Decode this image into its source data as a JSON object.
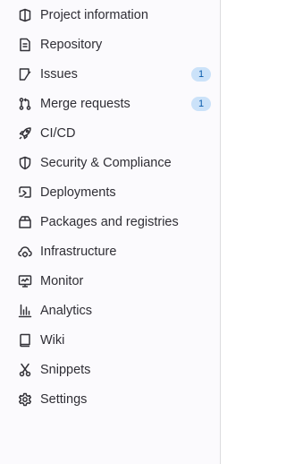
{
  "sidebar": {
    "items": [
      {
        "label": "Project information",
        "icon": "project-icon"
      },
      {
        "label": "Repository",
        "icon": "doc-text-icon"
      },
      {
        "label": "Issues",
        "icon": "issues-icon",
        "badge": "1"
      },
      {
        "label": "Merge requests",
        "icon": "merge-request-icon",
        "badge": "1"
      },
      {
        "label": "CI/CD",
        "icon": "rocket-icon"
      },
      {
        "label": "Security & Compliance",
        "icon": "shield-icon"
      },
      {
        "label": "Deployments",
        "icon": "deployments-icon"
      },
      {
        "label": "Packages and registries",
        "icon": "package-icon"
      },
      {
        "label": "Infrastructure",
        "icon": "cloud-gear-icon"
      },
      {
        "label": "Monitor",
        "icon": "monitor-icon"
      },
      {
        "label": "Analytics",
        "icon": "chart-icon"
      },
      {
        "label": "Wiki",
        "icon": "book-icon"
      },
      {
        "label": "Snippets",
        "icon": "snippet-icon"
      },
      {
        "label": "Settings",
        "icon": "settings-icon"
      }
    ]
  },
  "colors": {
    "badge_bg": "#cbe2f9",
    "badge_text": "#0b5cad",
    "text": "#2f2e35"
  }
}
